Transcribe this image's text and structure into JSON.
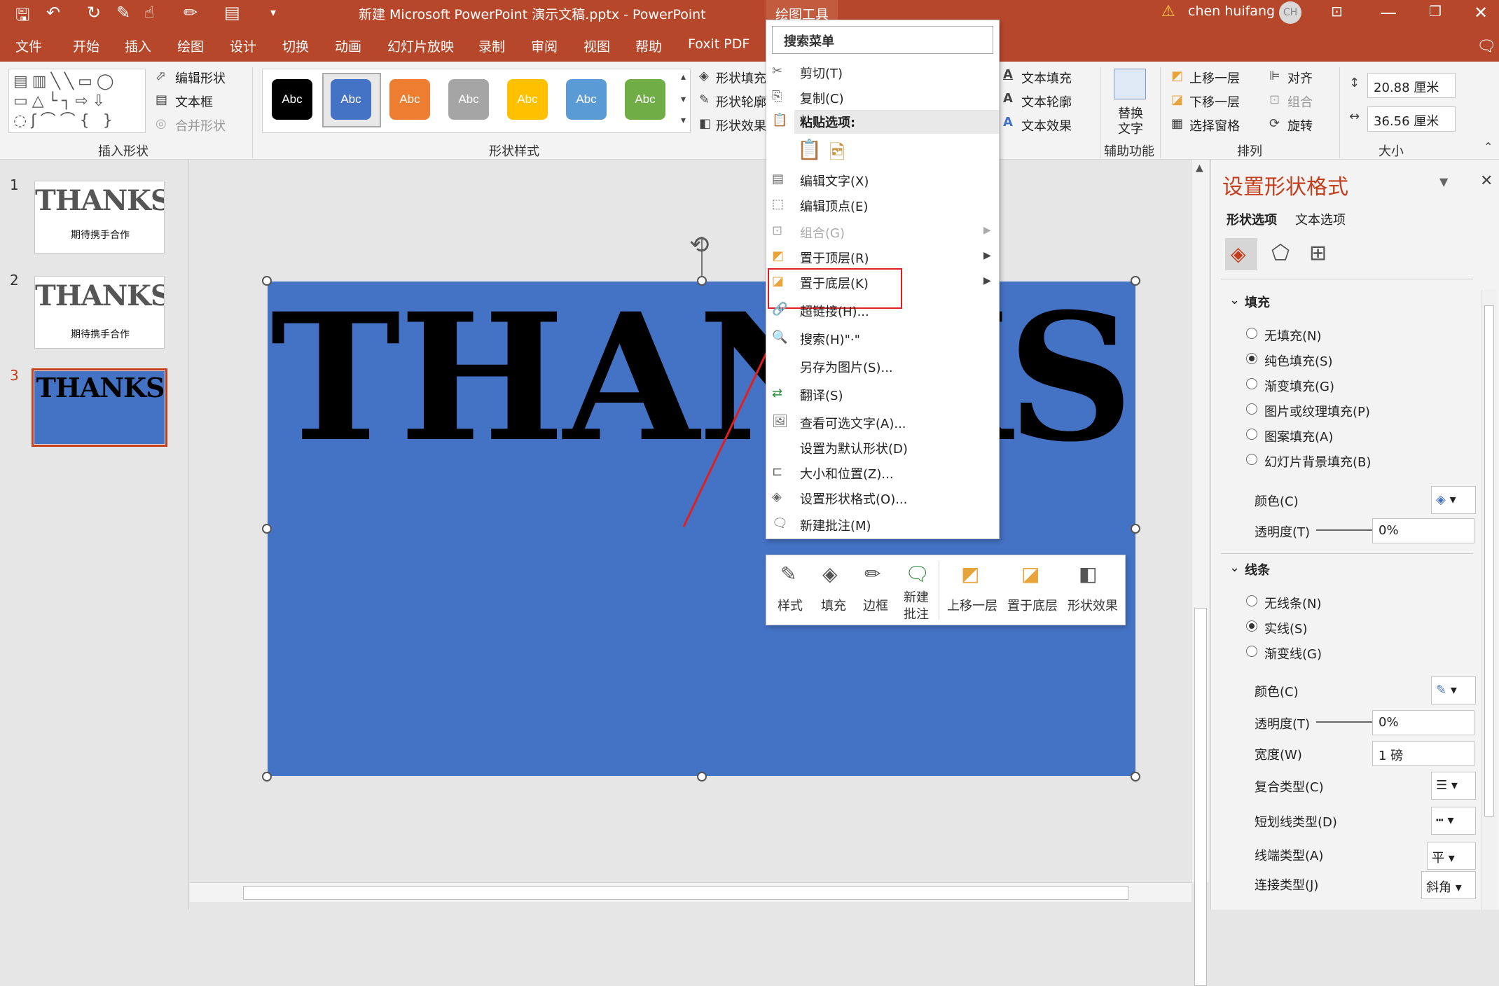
{
  "titlebar": {
    "doc_title": "新建 Microsoft PowerPoint 演示文稿.pptx  -  PowerPoint",
    "context_tab": "绘图工具",
    "user": "chen huifang",
    "initials": "CH"
  },
  "tabs": [
    "文件",
    "开始",
    "插入",
    "绘图",
    "设计",
    "切换",
    "动画",
    "幻灯片放映",
    "录制",
    "审阅",
    "视图",
    "帮助",
    "Foxit PDF"
  ],
  "ribbon": {
    "insert_shapes": {
      "edit_shape": "编辑形状",
      "text_box": "文本框",
      "merge_shapes": "合并形状",
      "group_label": "插入形状"
    },
    "shape_styles": {
      "swatches": [
        {
          "label": "Abc",
          "color": "#000000"
        },
        {
          "label": "Abc",
          "color": "#4472c4"
        },
        {
          "label": "Abc",
          "color": "#ed7d31"
        },
        {
          "label": "Abc",
          "color": "#a5a5a5"
        },
        {
          "label": "Abc",
          "color": "#ffc000"
        },
        {
          "label": "Abc",
          "color": "#5b9bd5"
        },
        {
          "label": "Abc",
          "color": "#70ad47"
        }
      ],
      "fill": "形状填充",
      "outline": "形状轮廓",
      "effects": "形状效果",
      "group_label": "形状样式"
    },
    "wordart": {
      "text_fill": "文本填充",
      "text_outline": "文本轮廓",
      "text_effects": "文本效果"
    },
    "accessibility": {
      "alt_text_line1": "替换",
      "alt_text_line2": "文字",
      "group_label": "辅助功能"
    },
    "arrange": {
      "bring_forward": "上移一层",
      "send_backward": "下移一层",
      "selection_pane": "选择窗格",
      "align": "对齐",
      "group": "组合",
      "rotate": "旋转",
      "group_label": "排列"
    },
    "size": {
      "height": "20.88 厘米",
      "width": "36.56 厘米",
      "group_label": "大小"
    }
  },
  "slides": [
    {
      "num": "1",
      "title": "THANKS",
      "subtitle": "期待携手合作"
    },
    {
      "num": "2",
      "title": "THANKS",
      "subtitle": "期待携手合作"
    },
    {
      "num": "3",
      "title": "THANKS",
      "subtitle": ""
    }
  ],
  "slide_text": "THANKS",
  "context_menu": {
    "search": "搜索菜单",
    "cut": "剪切(T)",
    "copy": "复制(C)",
    "paste_options": "粘贴选项:",
    "edit_text": "编辑文字(X)",
    "edit_points": "编辑顶点(E)",
    "group": "组合(G)",
    "bring_front": "置于顶层(R)",
    "send_back": "置于底层(K)",
    "hyperlink": "超链接(H)...",
    "search_item": "搜索(H)\"·\"",
    "save_picture": "另存为图片(S)...",
    "translate": "翻译(S)",
    "alt_text": "查看可选文字(A)...",
    "set_default": "设置为默认形状(D)",
    "size_position": "大小和位置(Z)...",
    "format_shape": "设置形状格式(O)...",
    "new_comment": "新建批注(M)"
  },
  "mini_toolbar": {
    "style": "样式",
    "fill": "填充",
    "border": "边框",
    "new_comment_1": "新建",
    "new_comment_2": "批注",
    "bring_forward": "上移一层",
    "send_back": "置于底层",
    "shape_effects": "形状效果"
  },
  "format_pane": {
    "title": "设置形状格式",
    "tab_shape": "形状选项",
    "tab_text": "文本选项",
    "fill_section": "填充",
    "fill_options": [
      "无填充(N)",
      "纯色填充(S)",
      "渐变填充(G)",
      "图片或纹理填充(P)",
      "图案填充(A)",
      "幻灯片背景填充(B)"
    ],
    "fill_selected": "纯色填充(S)",
    "color_label": "颜色(C)",
    "transparency_label": "透明度(T)",
    "transparency_value": "0%",
    "line_section": "线条",
    "line_options": [
      "无线条(N)",
      "实线(S)",
      "渐变线(G)"
    ],
    "line_selected": "实线(S)",
    "line_color_label": "颜色(C)",
    "line_transparency_label": "透明度(T)",
    "line_transparency_value": "0%",
    "width_label": "宽度(W)",
    "width_value": "1 磅",
    "compound_label": "复合类型(C)",
    "dash_label": "短划线类型(D)",
    "cap_label": "线端类型(A)",
    "cap_value": "平",
    "join_label": "连接类型(J)",
    "join_value": "斜角"
  }
}
